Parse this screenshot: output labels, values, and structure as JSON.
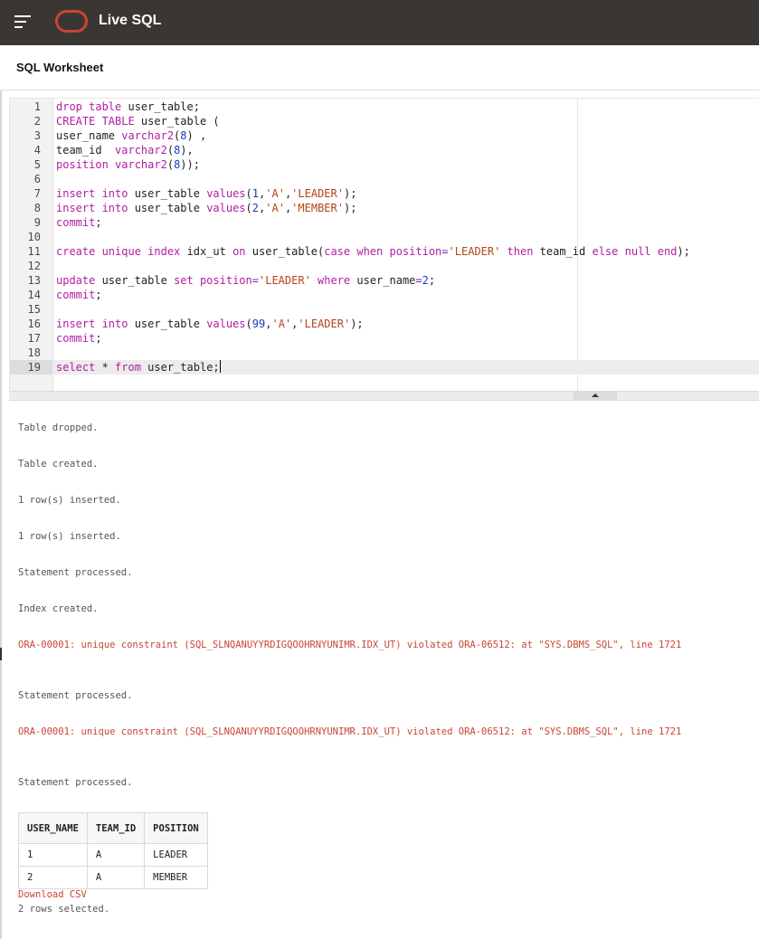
{
  "header": {
    "app_title": "Live SQL",
    "brand_color": "#c74634",
    "bar_color": "#3a3633"
  },
  "worksheet": {
    "title": "SQL Worksheet"
  },
  "editor": {
    "lines": [
      {
        "n": "1",
        "t": [
          [
            "k",
            "drop table"
          ],
          [
            "p",
            " user_table;"
          ]
        ]
      },
      {
        "n": "2",
        "t": [
          [
            "k",
            "CREATE TABLE"
          ],
          [
            "p",
            " user_table ("
          ]
        ]
      },
      {
        "n": "3",
        "t": [
          [
            "p",
            "user_name "
          ],
          [
            "k",
            "varchar2"
          ],
          [
            "p",
            "("
          ],
          [
            "n",
            "8"
          ],
          [
            "p",
            ") ,"
          ]
        ]
      },
      {
        "n": "4",
        "t": [
          [
            "p",
            "team_id  "
          ],
          [
            "k",
            "varchar2"
          ],
          [
            "p",
            "("
          ],
          [
            "n",
            "8"
          ],
          [
            "p",
            "),"
          ]
        ]
      },
      {
        "n": "5",
        "t": [
          [
            "k",
            "position"
          ],
          [
            "p",
            " "
          ],
          [
            "k",
            "varchar2"
          ],
          [
            "p",
            "("
          ],
          [
            "n",
            "8"
          ],
          [
            "p",
            "));"
          ]
        ]
      },
      {
        "n": "6",
        "t": []
      },
      {
        "n": "7",
        "t": [
          [
            "k",
            "insert into"
          ],
          [
            "p",
            " user_table "
          ],
          [
            "k",
            "values"
          ],
          [
            "p",
            "("
          ],
          [
            "n",
            "1"
          ],
          [
            "p",
            ","
          ],
          [
            "s",
            "'A'"
          ],
          [
            "p",
            ","
          ],
          [
            "s",
            "'LEADER'"
          ],
          [
            "p",
            ");"
          ]
        ]
      },
      {
        "n": "8",
        "t": [
          [
            "k",
            "insert into"
          ],
          [
            "p",
            " user_table "
          ],
          [
            "k",
            "values"
          ],
          [
            "p",
            "("
          ],
          [
            "n",
            "2"
          ],
          [
            "p",
            ","
          ],
          [
            "s",
            "'A'"
          ],
          [
            "p",
            ","
          ],
          [
            "s",
            "'MEMBER'"
          ],
          [
            "p",
            ");"
          ]
        ]
      },
      {
        "n": "9",
        "t": [
          [
            "k",
            "commit"
          ],
          [
            "p",
            ";"
          ]
        ]
      },
      {
        "n": "10",
        "t": []
      },
      {
        "n": "11",
        "t": [
          [
            "k",
            "create unique index"
          ],
          [
            "p",
            " idx_ut "
          ],
          [
            "k",
            "on"
          ],
          [
            "p",
            " user_table("
          ],
          [
            "k",
            "case when position"
          ],
          [
            "o",
            "="
          ],
          [
            "s",
            "'LEADER'"
          ],
          [
            "p",
            " "
          ],
          [
            "k",
            "then"
          ],
          [
            "p",
            " team_id "
          ],
          [
            "k",
            "else null end"
          ],
          [
            "p",
            ");"
          ]
        ]
      },
      {
        "n": "12",
        "t": []
      },
      {
        "n": "13",
        "t": [
          [
            "k",
            "update"
          ],
          [
            "p",
            " user_table "
          ],
          [
            "k",
            "set position"
          ],
          [
            "o",
            "="
          ],
          [
            "s",
            "'LEADER'"
          ],
          [
            "p",
            " "
          ],
          [
            "k",
            "where"
          ],
          [
            "p",
            " user_name"
          ],
          [
            "o",
            "="
          ],
          [
            "n",
            "2"
          ],
          [
            "p",
            ";"
          ]
        ]
      },
      {
        "n": "14",
        "t": [
          [
            "k",
            "commit"
          ],
          [
            "p",
            ";"
          ]
        ]
      },
      {
        "n": "15",
        "t": []
      },
      {
        "n": "16",
        "t": [
          [
            "k",
            "insert into"
          ],
          [
            "p",
            " user_table "
          ],
          [
            "k",
            "values"
          ],
          [
            "p",
            "("
          ],
          [
            "n",
            "99"
          ],
          [
            "p",
            ","
          ],
          [
            "s",
            "'A'"
          ],
          [
            "p",
            ","
          ],
          [
            "s",
            "'LEADER'"
          ],
          [
            "p",
            ");"
          ]
        ]
      },
      {
        "n": "17",
        "t": [
          [
            "k",
            "commit"
          ],
          [
            "p",
            ";"
          ]
        ]
      },
      {
        "n": "18",
        "t": []
      },
      {
        "n": "19",
        "t": [
          [
            "k",
            "select"
          ],
          [
            "p",
            " * "
          ],
          [
            "k",
            "from"
          ],
          [
            "p",
            " user_table;"
          ]
        ]
      }
    ],
    "active_line": "19"
  },
  "output": {
    "messages": [
      {
        "text": "Table dropped.",
        "type": "info"
      },
      {
        "text": "Table created.",
        "type": "info"
      },
      {
        "text": "1 row(s) inserted.",
        "type": "info"
      },
      {
        "text": "1 row(s) inserted.",
        "type": "info"
      },
      {
        "text": "Statement processed.",
        "type": "info"
      },
      {
        "text": "Index created.",
        "type": "info"
      },
      {
        "text": "ORA-00001: unique constraint (SQL_SLNQANUYYRDIGQOOHRNYUNIMR.IDX_UT) violated ORA-06512: at \"SYS.DBMS_SQL\", line 1721",
        "type": "error"
      },
      {
        "text": "Statement processed.",
        "type": "info"
      },
      {
        "text": "ORA-00001: unique constraint (SQL_SLNQANUYYRDIGQOOHRNYUNIMR.IDX_UT) violated ORA-06512: at \"SYS.DBMS_SQL\", line 1721",
        "type": "error"
      },
      {
        "text": "Statement processed.",
        "type": "info"
      }
    ],
    "table": {
      "columns": [
        "USER_NAME",
        "TEAM_ID",
        "POSITION"
      ],
      "rows": [
        [
          "1",
          "A",
          "LEADER"
        ],
        [
          "2",
          "A",
          "MEMBER"
        ]
      ]
    },
    "download_label": "Download CSV",
    "rows_selected": "2 rows selected."
  }
}
